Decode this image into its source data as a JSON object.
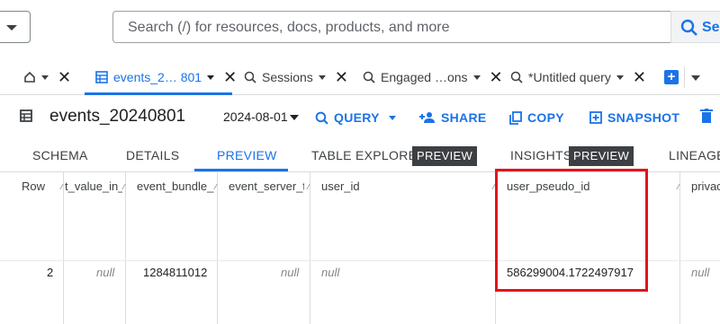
{
  "search": {
    "placeholder": "Search (/) for resources, docs, products, and more",
    "button_label": "Sea"
  },
  "tabs": [
    {
      "label": "",
      "icon": "home-icon"
    },
    {
      "label": "events_2… 801",
      "icon": "table-icon",
      "active": true
    },
    {
      "label": "Sessions",
      "icon": "query-icon"
    },
    {
      "label": "Engaged …ons",
      "icon": "query-icon"
    },
    {
      "label": "*Untitled query",
      "icon": "query-icon"
    }
  ],
  "toolbar": {
    "title": "events_20240801",
    "date": "2024-08-01",
    "query_label": "QUERY",
    "share_label": "SHARE",
    "copy_label": "COPY",
    "snapshot_label": "SNAPSHOT"
  },
  "subtabs": {
    "schema": "SCHEMA",
    "details": "DETAILS",
    "preview": "PREVIEW",
    "table_explorer": "TABLE EXPLORER",
    "table_explorer_badge": "PREVIEW",
    "insights": "INSIGHTS",
    "insights_badge": "PREVIEW",
    "lineage": "LINEAGE"
  },
  "grid": {
    "headers": [
      "Row",
      "t_value_in_u",
      "event_bundle_se",
      "event_server_tim",
      "user_id",
      "user_pseudo_id",
      "privac"
    ],
    "row": {
      "row": "2",
      "value": "null",
      "event_bundle": "1284811012",
      "server_time": "null",
      "user_id": "null",
      "user_pseudo_id": "586299004.1722497917",
      "privacy": "null"
    }
  },
  "colors": {
    "accent": "#1a73e8",
    "highlight": "#e3141b",
    "badge_bg": "#3c4043"
  }
}
